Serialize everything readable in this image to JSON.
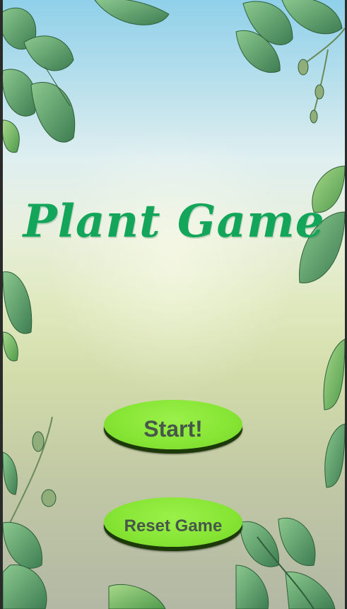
{
  "game": {
    "title": "Plant Game"
  },
  "menu": {
    "start_label": "Start!",
    "reset_label": "Reset Game"
  },
  "colors": {
    "title": "#13a65a",
    "button_fill": "#86e534",
    "button_shadow": "#1c3a08",
    "button_text": "#47584a",
    "leaf_dark": "#3f7a4a",
    "leaf_light": "#7fbf6a"
  }
}
